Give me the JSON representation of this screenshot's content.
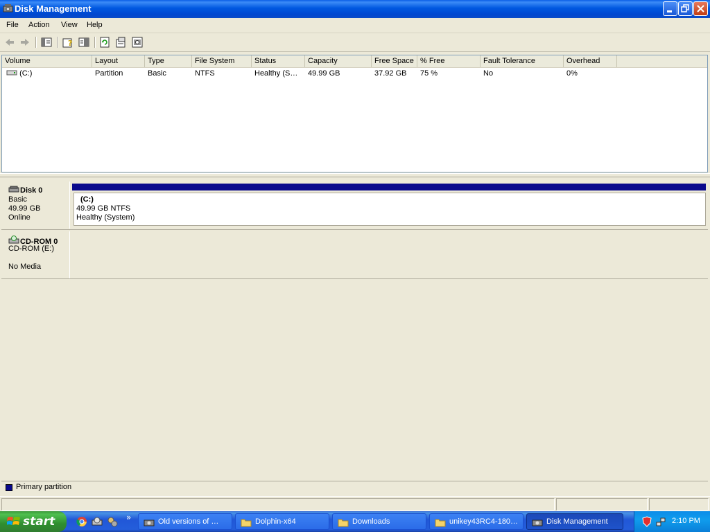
{
  "window": {
    "title": "Disk Management",
    "icon": "disk-management-icon"
  },
  "menu": [
    "File",
    "Action",
    "View",
    "Help"
  ],
  "toolbar": {
    "buttons": [
      "back-icon",
      "forward-icon",
      "show-hide-console-tree-icon",
      "help-icon",
      "properties-icon",
      "refresh-icon",
      "export-icon",
      "console-icon"
    ]
  },
  "volume_list": {
    "columns": [
      "Volume",
      "Layout",
      "Type",
      "File System",
      "Status",
      "Capacity",
      "Free Space",
      "% Free",
      "Fault Tolerance",
      "Overhead"
    ],
    "rows": [
      {
        "volume": "(C:)",
        "layout": "Partition",
        "type": "Basic",
        "file_system": "NTFS",
        "status": "Healthy (S…",
        "capacity": "49.99 GB",
        "free_space": "37.92 GB",
        "percent_free": "75 %",
        "fault_tolerance": "No",
        "overhead": "0%"
      }
    ]
  },
  "disks": [
    {
      "name": "Disk 0",
      "type": "Basic",
      "size": "49.99 GB",
      "state": "Online",
      "partition": {
        "label": "(C:)",
        "detail": "49.99 GB NTFS",
        "status": "Healthy (System)"
      }
    },
    {
      "name": "CD-ROM 0",
      "type": "CD-ROM (E:)",
      "state": "No Media"
    }
  ],
  "legend": {
    "label": "Primary partition",
    "color": "#0a0a8c"
  },
  "taskbar": {
    "start_label": "start",
    "quick_launch": [
      "chrome-icon",
      "disk-icon",
      "tools-icon"
    ],
    "overflow": "»",
    "tasks": [
      {
        "label": "Old versions of …",
        "icon": "disk-management-icon",
        "active": false
      },
      {
        "label": "Dolphin-x64",
        "icon": "folder-icon",
        "active": false
      },
      {
        "label": "Downloads",
        "icon": "folder-icon",
        "active": false
      },
      {
        "label": "unikey43RC4-180…",
        "icon": "folder-icon",
        "active": false
      },
      {
        "label": "Disk Management",
        "icon": "disk-management-icon",
        "active": true
      }
    ],
    "clock": "2:10 PM"
  }
}
